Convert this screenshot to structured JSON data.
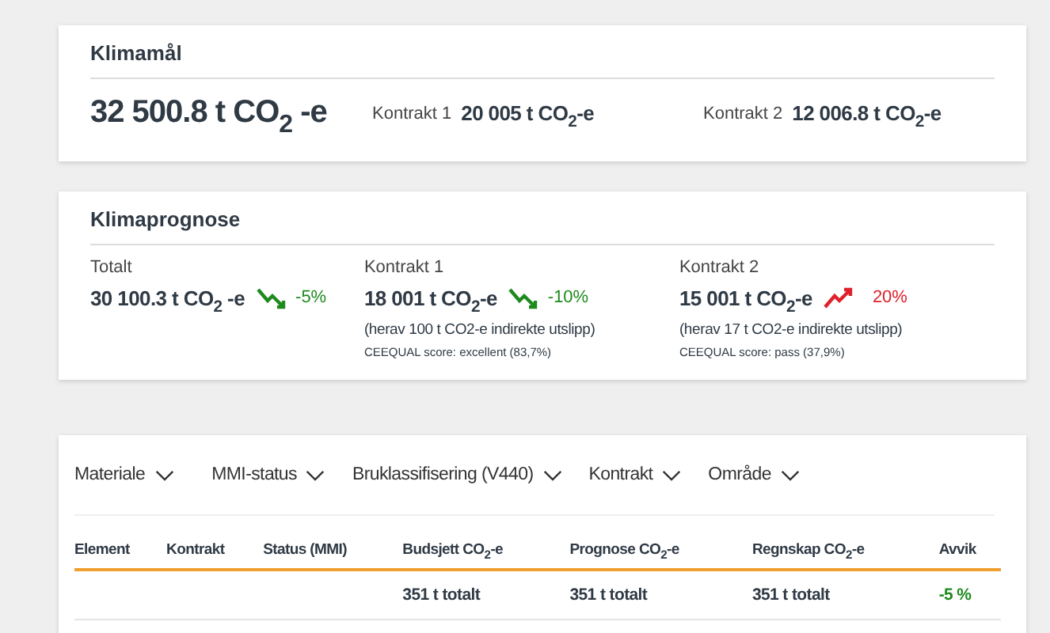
{
  "climate_goal": {
    "title": "Klimamål",
    "total": "32 500.8 t CO$_{2}$ -e",
    "contracts": [
      {
        "label": "Kontrakt 1",
        "value": "20 005 t CO$_{2}$-e"
      },
      {
        "label": "Kontrakt 2",
        "value": "12 006.8 t CO$_{2}$-e"
      }
    ]
  },
  "forecast": {
    "title": "Klimaprognose",
    "items": [
      {
        "label": "Totalt",
        "value": "30 100.3 t CO$_{2}$ -e",
        "kind": "decrease",
        "change": "-5%"
      },
      {
        "label": "Kontrakt 1",
        "value": "18 001 t CO$_{2}$-e",
        "kind": "decrease",
        "change": "-10%",
        "note": "(herav 100 t CO2-e indirekte utslipp)",
        "score": "CEEQUAL score: excellent (83,7%)"
      },
      {
        "label": "Kontrakt 2",
        "value": "15 001 t CO$_{2}$-e",
        "kind": "increase",
        "change": "20%",
        "note": "(herav 17 t CO2-e indirekte utslipp)",
        "score": "CEEQUAL score: pass (37,9%)"
      }
    ]
  },
  "filters": [
    "Materiale",
    "MMI-status",
    "Bruklassifisering (V440)",
    "Kontrakt",
    "Område"
  ],
  "table": {
    "columns": [
      "Element",
      "Kontrakt",
      "Status (MMI)",
      "Budsjett CO$_{2}$-e",
      "Prognose CO$_{2}$-e",
      "Regnskap CO$_{2}$-e",
      "Avvik"
    ],
    "totals": [
      "351 t totalt",
      "351 t totalt",
      "351 t totalt",
      "-5 %"
    ]
  }
}
